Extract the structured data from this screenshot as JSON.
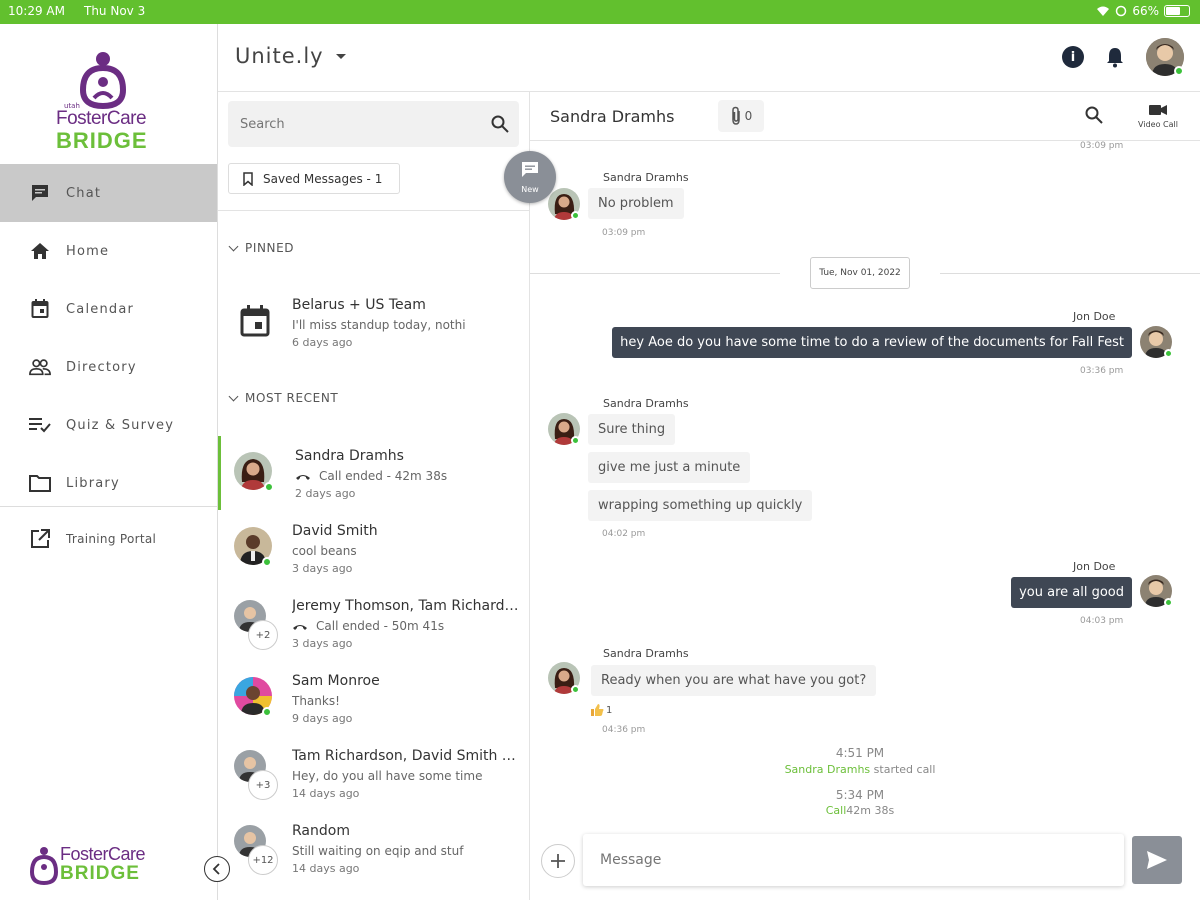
{
  "status": {
    "time": "10:29 AM",
    "date": "Thu Nov 3",
    "battery": "66%"
  },
  "sidebar": {
    "logo_utah": "utah",
    "logo_line1": "FosterCare",
    "logo_line2": "BRIDGE",
    "items": [
      {
        "label": "Chat",
        "icon": "chat-icon",
        "active": true
      },
      {
        "label": "Home",
        "icon": "home-icon"
      },
      {
        "label": "Calendar",
        "icon": "calendar-icon"
      },
      {
        "label": "Directory",
        "icon": "people-icon"
      },
      {
        "label": "Quiz & Survey",
        "icon": "checklist-icon"
      },
      {
        "label": "Library",
        "icon": "folder-icon"
      },
      {
        "label": "Training Portal",
        "icon": "external-link-icon"
      }
    ]
  },
  "header": {
    "app_name": "Unite.ly"
  },
  "list": {
    "search_placeholder": "Search",
    "saved_messages": "Saved Messages - 1",
    "new_label": "New",
    "pinned_label": "PINNED",
    "recent_label": "MOST RECENT",
    "pinned": [
      {
        "name": "Belarus + US Team",
        "preview": "I'll miss standup today, nothi",
        "time": "6 days ago"
      }
    ],
    "recent": [
      {
        "name": "Sandra Dramhs",
        "preview": "Call ended - 42m 38s",
        "time": "2 days ago",
        "call": true
      },
      {
        "name": "David Smith",
        "preview": "cool beans",
        "time": "3 days ago"
      },
      {
        "name": "Jeremy Thomson, Tam Richard…",
        "preview": "Call ended - 50m 41s",
        "time": "3 days ago",
        "call": true,
        "extra": "+2"
      },
      {
        "name": "Sam Monroe",
        "preview": "Thanks!",
        "time": "9 days ago"
      },
      {
        "name": "Tam Richardson, David Smith …",
        "preview": "Hey, do you all have some time",
        "time": "14 days ago",
        "extra": "+3"
      },
      {
        "name": "Random",
        "preview": "Still waiting on eqip and stuf",
        "time": "14 days ago",
        "extra": "+12"
      }
    ]
  },
  "chat": {
    "contact": "Sandra Dramhs",
    "attachments": "0",
    "video_call": "Video Call",
    "top_time": "03:09 pm",
    "date_chip": "Tue, Nov 01, 2022",
    "m1_sender": "Sandra Dramhs",
    "m1_text": "No problem",
    "m1_time": "03:09 pm",
    "m2_sender": "Jon Doe",
    "m2_text": "hey Aoe do you have some time to do a review of the documents for Fall Fest",
    "m2_time": "03:36 pm",
    "m3_sender": "Sandra Dramhs",
    "m3_text1": "Sure thing",
    "m3_text2": "give me just a minute",
    "m3_text3": "wrapping something up quickly",
    "m3_time": "04:02 pm",
    "m4_sender": "Jon Doe",
    "m4_text": "you are all good",
    "m4_time": "04:03 pm",
    "m5_sender": "Sandra Dramhs",
    "m5_text": "Ready when you are what have you got?",
    "m5_reaction": "1",
    "m5_time": "04:36 pm",
    "sys1_time": "4:51 PM",
    "sys1_name": "Sandra Dramhs",
    "sys1_text": "started call",
    "sys2_time": "5:34 PM",
    "sys2_label": "Call",
    "sys2_text": "42m 38s",
    "composer_placeholder": "Message"
  },
  "colors": {
    "status_bar": "#62c02e",
    "brand_green": "#6cbf3a",
    "brand_purple": "#6b2d83",
    "outgoing_bubble": "#3f4754",
    "online": "#3cc13b"
  }
}
